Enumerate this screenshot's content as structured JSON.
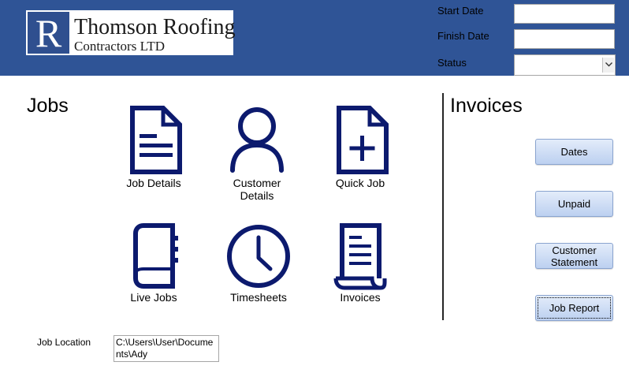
{
  "header": {
    "logo": {
      "letter": "R",
      "line1": "Thomson Roofing",
      "line2": "Contractors LTD"
    },
    "start_date_label": "Start Date",
    "finish_date_label": "Finish Date",
    "status_label": "Status",
    "start_date_value": "",
    "finish_date_value": "",
    "status_value": ""
  },
  "jobs": {
    "title": "Jobs",
    "tiles": [
      {
        "label": "Job Details",
        "icon": "document-lines-icon"
      },
      {
        "label": "Customer Details",
        "icon": "person-icon"
      },
      {
        "label": "Quick Job",
        "icon": "document-plus-icon"
      },
      {
        "label": "Live Jobs",
        "icon": "notebook-icon"
      },
      {
        "label": "Timesheets",
        "icon": "clock-icon"
      },
      {
        "label": "Invoices",
        "icon": "scroll-document-icon"
      }
    ]
  },
  "invoices": {
    "title": "Invoices",
    "buttons": [
      "Dates",
      "Unpaid",
      "Customer Statement",
      "Job Report"
    ]
  },
  "job_location": {
    "label": "Job Location",
    "value": "C:\\Users\\User\\Documents\\Ady"
  },
  "colors": {
    "header_bg": "#2f5496",
    "icon_color": "#0c1a6e",
    "button_bg": "#c9daf5"
  }
}
